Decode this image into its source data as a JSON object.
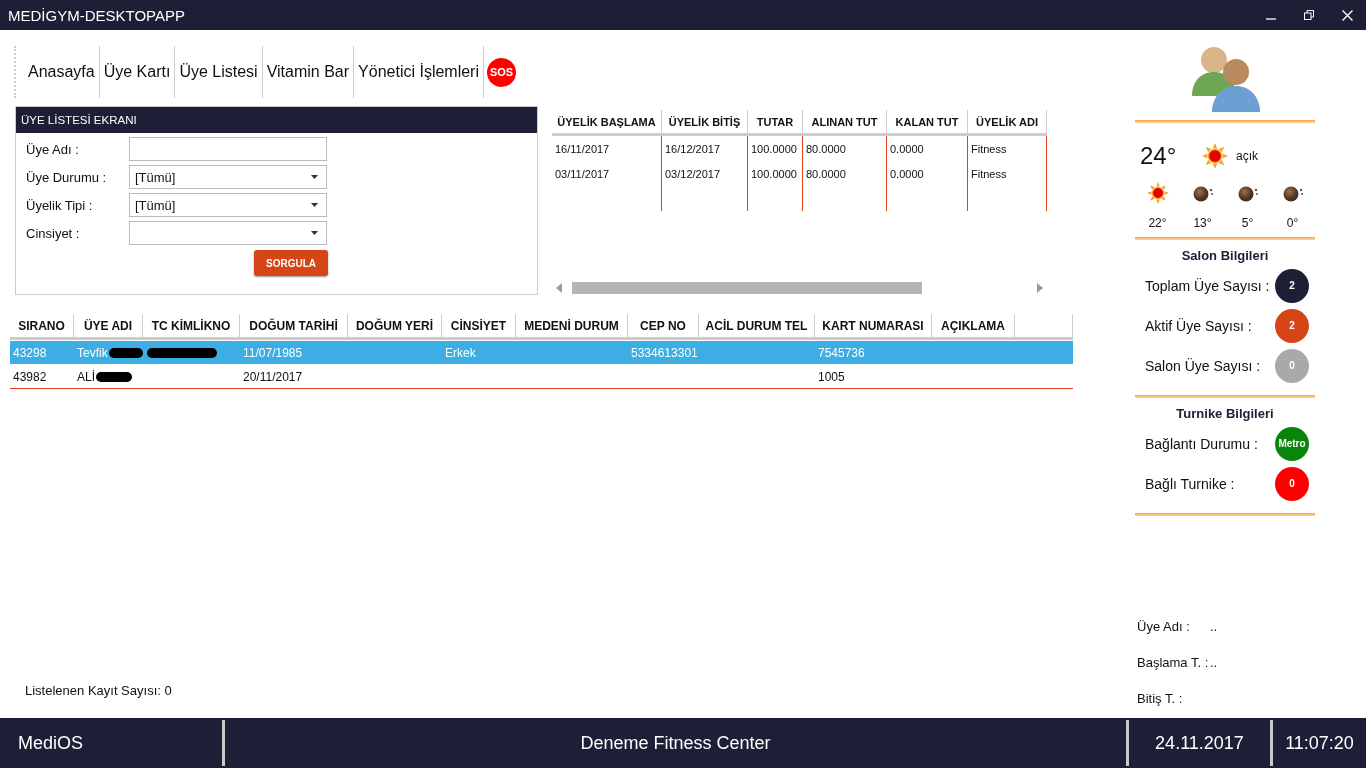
{
  "window": {
    "title": "MEDİGYM-DESKTOPAPP"
  },
  "nav": {
    "items": [
      "Anasayfa",
      "Üye Kartı",
      "Üye Listesi",
      "Vitamin Bar",
      "Yönetici İşlemleri"
    ],
    "sos": "SOS"
  },
  "filter_panel": {
    "title": "ÜYE LİSTESİ EKRANI",
    "fields": [
      {
        "kind": "text",
        "label": "Üye Adı :"
      },
      {
        "kind": "dropdown",
        "label": "Üye Durumu :",
        "value": "[Tümü]"
      },
      {
        "kind": "dropdown",
        "label": "Üyelik Tipi :",
        "value": "[Tümü]"
      },
      {
        "kind": "dropdown",
        "label": "Cinsiyet :"
      }
    ],
    "button": "SORGULA"
  },
  "membership_table": {
    "columns": [
      "ÜYELİK BAŞLAMA",
      "ÜYELİK BİTİŞ",
      "TUTAR",
      "ALINAN TUT",
      "KALAN TUT",
      "ÜYELİK ADI"
    ],
    "rows": [
      [
        "16/11/2017",
        "16/12/2017",
        "100.0000",
        "80.0000",
        "0.0000",
        "Fitness"
      ],
      [
        "03/11/2017",
        "03/12/2017",
        "100.0000",
        "80.0000",
        "0.0000",
        "Fitness"
      ]
    ]
  },
  "members_table": {
    "columns": [
      "SIRANO",
      "ÜYE ADI",
      "TC KİMLİKNO",
      "DOĞUM TARİHİ",
      "DOĞUM YERİ",
      "CİNSİYET",
      "MEDENİ DURUM",
      "CEP NO",
      "ACİL DURUM TEL",
      "KART NUMARASI",
      "AÇIKLAMA"
    ],
    "rows": [
      {
        "selected": true,
        "cells": [
          "43298",
          {
            "text": "Tevfik",
            "redacted": true
          },
          {
            "redacted": true
          },
          "11/07/1985",
          null,
          "Erkek",
          null,
          "5334613301",
          null,
          "7545736",
          null
        ]
      },
      {
        "selected": false,
        "cells": [
          "43982",
          {
            "text": "ALİ",
            "redacted": true
          },
          null,
          "20/11/2017",
          null,
          null,
          null,
          null,
          null,
          "1005",
          null
        ]
      }
    ]
  },
  "record_count": "Listelenen Kayıt Sayısı: 0",
  "weather": {
    "temperature": "24°",
    "kind": "sun",
    "condition": "açık",
    "forecast": [
      {
        "kind": "sun",
        "temperature": "22°"
      },
      {
        "kind": "night",
        "temperature": "13°"
      },
      {
        "kind": "night",
        "temperature": "5°"
      },
      {
        "kind": "night",
        "temperature": "0°"
      }
    ]
  },
  "salon": {
    "title": "Salon Bilgileri",
    "stats": [
      {
        "label": "Toplam Üye Sayısı :",
        "value": "2",
        "color": "#1c1f35"
      },
      {
        "label": "Aktif Üye Sayısı :",
        "value": "2",
        "color": "#d64516"
      },
      {
        "label": "Salon Üye Sayısı :",
        "value": "0",
        "color": "#a9a9a9"
      }
    ]
  },
  "turnike": {
    "title": "Turnike Bilgileri",
    "stats": [
      {
        "label": "Bağlantı Durumu :",
        "value": "Metro",
        "color": "#0a840a"
      },
      {
        "label": "Bağlı Turnike :",
        "value": "0",
        "color": "#ff0000"
      }
    ]
  },
  "member_info": [
    {
      "label": "Üye Adı :",
      "value": ".."
    },
    {
      "label": "Başlama T. :",
      "value": ".."
    },
    {
      "label": "Bitiş T. :"
    }
  ],
  "status_bar": {
    "app": "MediOS",
    "center": "Deneme Fitness Center",
    "date": "24.11.2017",
    "time": "11:07:20"
  }
}
